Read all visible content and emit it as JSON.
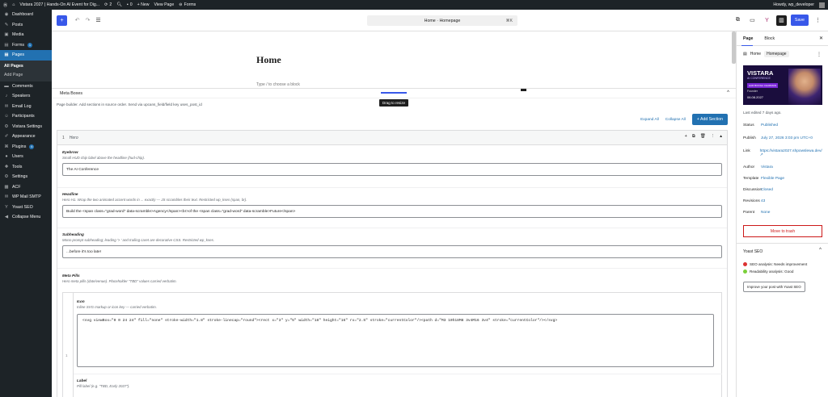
{
  "admin_bar": {
    "site_title": "Vistara 2027 | Hands-On AI Event for Dig...",
    "updates": "2",
    "comments": "0",
    "new_label": "+ New",
    "view_page": "View Page",
    "forms": "Forms",
    "howdy": "Howdy, wp_developer"
  },
  "sidebar": {
    "items": [
      {
        "label": "Dashboard",
        "icon": "dashboard-icon"
      },
      {
        "label": "Posts",
        "icon": "pin-icon"
      },
      {
        "label": "Media",
        "icon": "media-icon"
      },
      {
        "label": "Forms",
        "icon": "forms-icon",
        "badge": "1"
      },
      {
        "label": "Pages",
        "icon": "pages-icon",
        "active": true
      }
    ],
    "submenu": [
      "All Pages",
      "Add Page"
    ],
    "items2": [
      {
        "label": "Comments",
        "icon": "comment-icon"
      },
      {
        "label": "Speakers",
        "icon": "speakers-icon"
      },
      {
        "label": "Email Log",
        "icon": "email-icon"
      },
      {
        "label": "Participants",
        "icon": "participants-icon"
      },
      {
        "label": "Vistara Settings",
        "icon": "settings-icon"
      },
      {
        "label": "Appearance",
        "icon": "appearance-icon"
      },
      {
        "label": "Plugins",
        "icon": "plugins-icon",
        "badge": "6"
      },
      {
        "label": "Users",
        "icon": "users-icon"
      },
      {
        "label": "Tools",
        "icon": "tools-icon"
      },
      {
        "label": "Settings",
        "icon": "settings-icon"
      },
      {
        "label": "ACF",
        "icon": "acf-icon"
      },
      {
        "label": "WP Mail SMTP",
        "icon": "mail-icon"
      },
      {
        "label": "Yoast SEO",
        "icon": "yoast-icon"
      },
      {
        "label": "Collapse Menu",
        "icon": "collapse-icon"
      }
    ]
  },
  "topbar": {
    "doc_title": "Home · Homepage",
    "doc_shortcut": "⌘K",
    "save_label": "Save"
  },
  "canvas": {
    "heading": "Home",
    "placeholder": "Type / to choose a block",
    "drag_tip": "Drag to resize"
  },
  "metabox": {
    "title": "Meta Boxes",
    "description": "Page builder. Add sections in source order. Send via upcans_field/field key uses_post_id",
    "expand_all": "Expand All",
    "collapse_all": "Collapse All",
    "add_section": "+ Add Section",
    "section": {
      "number": "1",
      "title": "Hero",
      "fields": [
        {
          "label": "Eyebrow",
          "help": "Small HUD chip label above the headline (hud-chip).",
          "value": "The AI Conference"
        },
        {
          "label": "Headline",
          "help": "Hero H1. Wrap the two animated accent words in ... exactly — JS scrambles their text. Restricted wp_kses (span, br).",
          "value": "Build the <span class=\"grad-word\" data-scramble>Agency</span><br>of the <span class=\"grad-word\" data-scramble>Future</span>"
        },
        {
          "label": "Subheading",
          "help": "Mono-prompt subheading; leading '> ' and trailing caret are decorative CSS. Restricted wp_kses.",
          "value": "...before it's too late!"
        },
        {
          "label": "Meta Pills",
          "help": "Hero meta pills (date/venue). Placeholder \"TBD\" values carried verbatim.",
          "value": ""
        }
      ],
      "subfields": [
        {
          "label": "Icon",
          "help": "Inline SVG markup or icon key — carried verbatim.",
          "value": "<svg viewBox=\"0 0 24 24\" fill=\"none\" stroke-width=\"1.8\" stroke-linecap=\"round\"><rect x=\"3\" y=\"5\" width=\"18\" height=\"16\" rx=\"2.5\" stroke=\"currentColor\"/><path d=\"M3 10h18M8 3v4M16 3v4\" stroke=\"currentColor\"/></svg>"
        },
        {
          "label": "Label",
          "help": "Pill label (e.g. \"TBD, Early 2027\").",
          "value": ""
        }
      ],
      "index": "1"
    }
  },
  "right_panel": {
    "tab_page": "Page",
    "tab_block": "Block",
    "page_title": "Home",
    "page_pill": "Homepage",
    "featured_brand": "VISTARA",
    "featured_sub": "AI CONFERENCE",
    "featured_name": "HAR BOOGA CHARMAN",
    "featured_tag": "Founder",
    "featured_date": "06.08.2027",
    "last_edited": "Last edited 7 days ago.",
    "rows": [
      {
        "k": "Status",
        "v": "Published"
      },
      {
        "k": "Publish",
        "v": "July 27, 2026 3:03 pm UTC+0"
      },
      {
        "k": "Link",
        "v": "https://vistara2027.shpowslewa.dev/ ↗"
      },
      {
        "k": "Author",
        "v": "Vistara"
      },
      {
        "k": "Template",
        "v": "Flexible Page"
      },
      {
        "k": "Discussion",
        "v": "Closed"
      },
      {
        "k": "Revisions",
        "v": "43"
      },
      {
        "k": "Parent",
        "v": "None"
      }
    ],
    "trash_label": "Move to trash",
    "yoast_title": "Yoast SEO",
    "seo_analysis": "SEO analysis: Needs improvement",
    "readability": "Readability analysis: Good",
    "yoast_button": "Improve your post with Yoast SEO"
  }
}
